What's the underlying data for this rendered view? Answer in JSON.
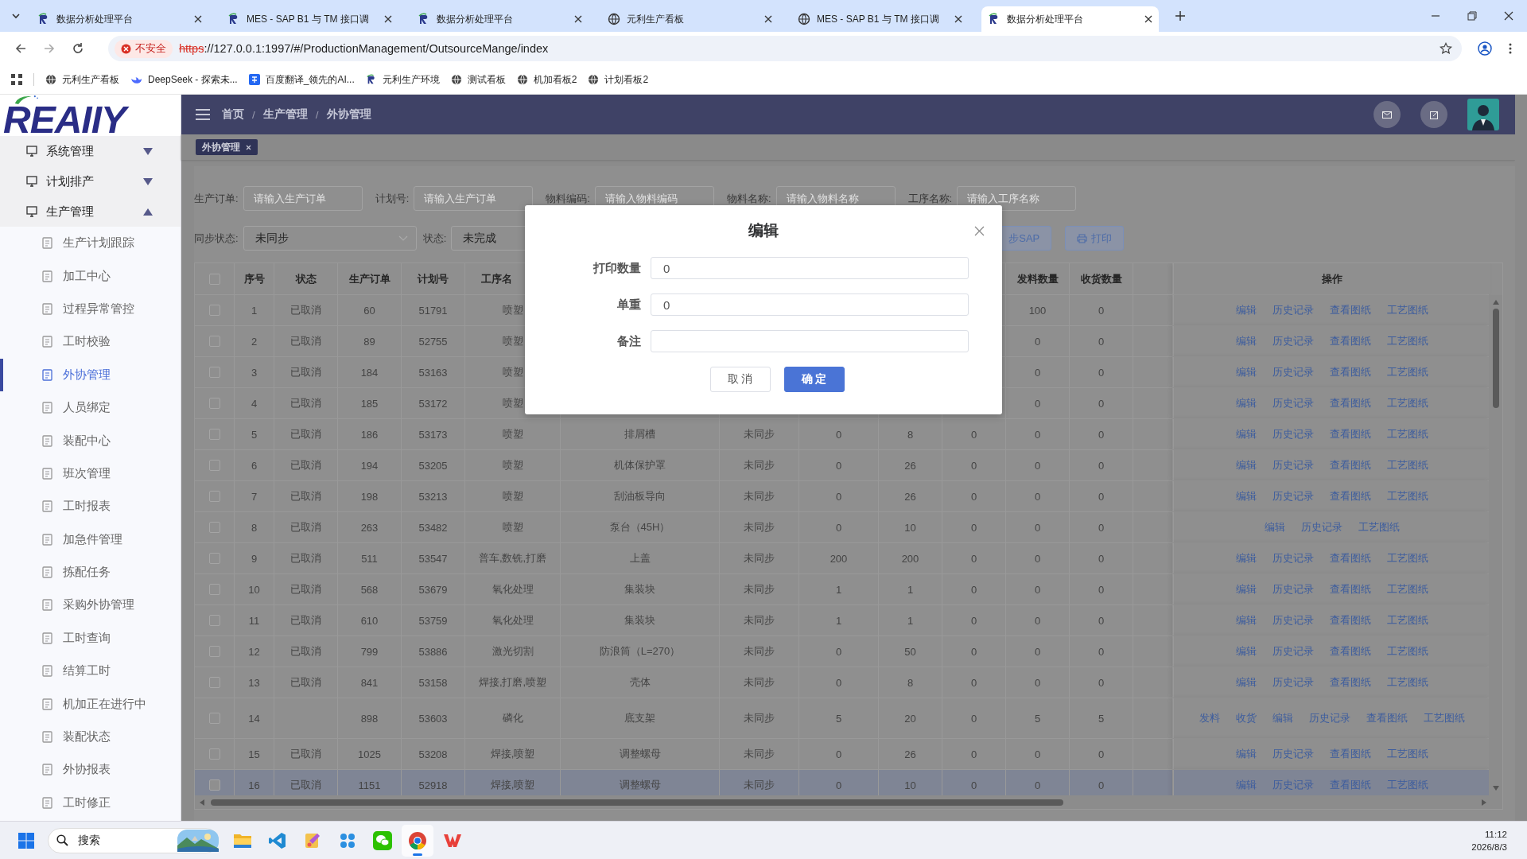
{
  "browser": {
    "tabs": [
      {
        "title": "数据分析处理平台",
        "kind": "app",
        "selected": false
      },
      {
        "title": "MES - SAP B1 与 TM 接口调",
        "kind": "app",
        "selected": false
      },
      {
        "title": "数据分析处理平台",
        "kind": "app",
        "selected": false
      },
      {
        "title": "元利生产看板",
        "kind": "globe",
        "selected": false
      },
      {
        "title": "MES - SAP B1 与 TM 接口调",
        "kind": "globe",
        "selected": false
      },
      {
        "title": "数据分析处理平台",
        "kind": "app",
        "selected": true
      }
    ],
    "security": "不安全",
    "url_scheme": "https",
    "url_rest": "://127.0.0.1:1997/#/ProductionManagement/OutsourceMange/index",
    "bookmarks": [
      {
        "label": "元利生产看板",
        "kind": "globe"
      },
      {
        "label": "DeepSeek - 探索未...",
        "kind": "whale"
      },
      {
        "label": "百度翻译_领先的AI...",
        "kind": "translate"
      },
      {
        "label": "元利生产环境",
        "kind": "app"
      },
      {
        "label": "测试看板",
        "kind": "globe"
      },
      {
        "label": "机加看板2",
        "kind": "globe"
      },
      {
        "label": "计划看板2",
        "kind": "globe"
      }
    ]
  },
  "sidebar": {
    "logo": "REAIIY",
    "menu": [
      {
        "label": "系统管理",
        "expanded": false
      },
      {
        "label": "计划排产",
        "expanded": false
      },
      {
        "label": "生产管理",
        "expanded": true,
        "children": [
          {
            "label": "生产计划跟踪",
            "selected": false
          },
          {
            "label": "加工中心",
            "selected": false
          },
          {
            "label": "过程异常管控",
            "selected": false
          },
          {
            "label": "工时校验",
            "selected": false
          },
          {
            "label": "外协管理",
            "selected": true
          },
          {
            "label": "人员绑定",
            "selected": false
          },
          {
            "label": "装配中心",
            "selected": false
          },
          {
            "label": "班次管理",
            "selected": false
          },
          {
            "label": "工时报表",
            "selected": false
          },
          {
            "label": "加急件管理",
            "selected": false
          },
          {
            "label": "拣配任务",
            "selected": false
          },
          {
            "label": "采购外协管理",
            "selected": false
          },
          {
            "label": "工时查询",
            "selected": false
          },
          {
            "label": "结算工时",
            "selected": false
          },
          {
            "label": "机加正在进行中",
            "selected": false
          },
          {
            "label": "装配状态",
            "selected": false
          },
          {
            "label": "外协报表",
            "selected": false
          },
          {
            "label": "工时修正",
            "selected": false
          }
        ]
      }
    ]
  },
  "header": {
    "breadcrumb": [
      "首页",
      "生产管理",
      "外协管理"
    ],
    "separator": "/"
  },
  "tags": [
    {
      "label": "外协管理",
      "selected": true
    }
  ],
  "filters": [
    {
      "label": "生产订单:",
      "placeholder": "请输入生产订单"
    },
    {
      "label": "计划号:",
      "placeholder": "请输入生产订单"
    },
    {
      "label": "物料编码:",
      "placeholder": "请输入物料编码"
    },
    {
      "label": "物料名称:",
      "placeholder": "请输入物料名称"
    },
    {
      "label": "工序名称:",
      "placeholder": "请输入工序名称"
    }
  ],
  "selects": [
    {
      "label": "同步状态:",
      "value": "未同步"
    },
    {
      "label": "状态:",
      "value": "未完成"
    }
  ],
  "toolbar_buttons": [
    {
      "label": "步SAP",
      "kind": "plain"
    },
    {
      "label": "打印",
      "kind": "print"
    }
  ],
  "table": {
    "header_checked": false,
    "columns": [
      "序号",
      "状态",
      "生产订单",
      "计划号",
      "工序名",
      null,
      null,
      null,
      null,
      null,
      "发料数量",
      "收货数量"
    ],
    "actions_header": "操作",
    "rows": [
      {
        "checked": false,
        "selected": false,
        "cells": [
          "1",
          "已取消",
          "60",
          "51791",
          "喷塑",
          null,
          null,
          null,
          null,
          null,
          "100",
          "0"
        ],
        "actions": [
          "编辑",
          "历史记录",
          "查看图纸",
          "工艺图纸"
        ]
      },
      {
        "checked": false,
        "selected": false,
        "cells": [
          "2",
          "已取消",
          "89",
          "52755",
          "喷塑",
          null,
          null,
          null,
          null,
          null,
          "0",
          "0"
        ],
        "actions": [
          "编辑",
          "历史记录",
          "查看图纸",
          "工艺图纸"
        ]
      },
      {
        "checked": false,
        "selected": false,
        "cells": [
          "3",
          "已取消",
          "184",
          "53163",
          "喷塑",
          null,
          null,
          null,
          null,
          null,
          "0",
          "0"
        ],
        "actions": [
          "编辑",
          "历史记录",
          "查看图纸",
          "工艺图纸"
        ]
      },
      {
        "checked": false,
        "selected": false,
        "cells": [
          "4",
          "已取消",
          "185",
          "53172",
          "喷塑",
          null,
          null,
          null,
          null,
          null,
          "0",
          "0"
        ],
        "actions": [
          "编辑",
          "历史记录",
          "查看图纸",
          "工艺图纸"
        ]
      },
      {
        "checked": false,
        "selected": false,
        "cells": [
          "5",
          "已取消",
          "186",
          "53173",
          "喷塑",
          "排屑槽",
          "未同步",
          "0",
          "8",
          "0",
          "0",
          "0"
        ],
        "actions": [
          "编辑",
          "历史记录",
          "查看图纸",
          "工艺图纸"
        ]
      },
      {
        "checked": false,
        "selected": false,
        "cells": [
          "6",
          "已取消",
          "194",
          "53205",
          "喷塑",
          "机体保护罩",
          "未同步",
          "0",
          "26",
          "0",
          "0",
          "0"
        ],
        "actions": [
          "编辑",
          "历史记录",
          "查看图纸",
          "工艺图纸"
        ]
      },
      {
        "checked": false,
        "selected": false,
        "cells": [
          "7",
          "已取消",
          "198",
          "53213",
          "喷塑",
          "刮油板导向",
          "未同步",
          "0",
          "26",
          "0",
          "0",
          "0"
        ],
        "actions": [
          "编辑",
          "历史记录",
          "查看图纸",
          "工艺图纸"
        ]
      },
      {
        "checked": false,
        "selected": false,
        "cells": [
          "8",
          "已取消",
          "263",
          "53482",
          "喷塑",
          "泵台（45H）",
          "未同步",
          "0",
          "10",
          "0",
          "0",
          "0"
        ],
        "actions": [
          "编辑",
          "历史记录",
          "工艺图纸"
        ]
      },
      {
        "checked": false,
        "selected": false,
        "cells": [
          "9",
          "已取消",
          "511",
          "53547",
          "普车,数铣,打磨",
          "上盖",
          "未同步",
          "200",
          "200",
          "0",
          "0",
          "0"
        ],
        "actions": [
          "编辑",
          "历史记录",
          "查看图纸",
          "工艺图纸"
        ]
      },
      {
        "checked": false,
        "selected": false,
        "cells": [
          "10",
          "已取消",
          "568",
          "53679",
          "氧化处理",
          "集装块",
          "未同步",
          "1",
          "1",
          "0",
          "0",
          "0"
        ],
        "actions": [
          "编辑",
          "历史记录",
          "查看图纸",
          "工艺图纸"
        ]
      },
      {
        "checked": false,
        "selected": false,
        "cells": [
          "11",
          "已取消",
          "610",
          "53759",
          "氧化处理",
          "集装块",
          "未同步",
          "1",
          "1",
          "0",
          "0",
          "0"
        ],
        "actions": [
          "编辑",
          "历史记录",
          "查看图纸",
          "工艺图纸"
        ]
      },
      {
        "checked": false,
        "selected": false,
        "cells": [
          "12",
          "已取消",
          "799",
          "53886",
          "激光切割",
          "防浪筒（L=270）",
          "未同步",
          "0",
          "50",
          "0",
          "0",
          "0"
        ],
        "actions": [
          "编辑",
          "历史记录",
          "查看图纸",
          "工艺图纸"
        ]
      },
      {
        "checked": false,
        "selected": false,
        "cells": [
          "13",
          "已取消",
          "841",
          "53158",
          "焊接,打磨,喷塑",
          "壳体",
          "未同步",
          "0",
          "8",
          "0",
          "0",
          "0"
        ],
        "actions": [
          "编辑",
          "历史记录",
          "查看图纸",
          "工艺图纸"
        ]
      },
      {
        "checked": false,
        "selected": false,
        "cells": [
          "14",
          null,
          "898",
          "53603",
          "磷化",
          "底支架",
          "未同步",
          "5",
          "20",
          "0",
          "5",
          "5"
        ],
        "actions": [
          "发料",
          "收货",
          "编辑",
          "历史记录",
          "查看图纸",
          "工艺图纸"
        ]
      },
      {
        "checked": false,
        "selected": false,
        "cells": [
          "15",
          "已取消",
          "1025",
          "53208",
          "焊接,喷塑",
          "调整螺母",
          "未同步",
          "0",
          "26",
          "0",
          "0",
          "0"
        ],
        "actions": [
          "编辑",
          "历史记录",
          "查看图纸",
          "工艺图纸"
        ]
      },
      {
        "checked": false,
        "selected": true,
        "cells": [
          "16",
          "已取消",
          "1151",
          "52918",
          "焊接,喷塑",
          "调整螺母",
          "未同步",
          "0",
          "10",
          "0",
          "0",
          "0"
        ],
        "actions": [
          "编辑",
          "历史记录",
          "查看图纸",
          "工艺图纸"
        ]
      }
    ]
  },
  "dialog": {
    "title": "编辑",
    "fields": [
      {
        "label": "打印数量",
        "value": "0"
      },
      {
        "label": "单重",
        "value": "0"
      },
      {
        "label": "备注"
      }
    ],
    "buttons": [
      {
        "label": "取 消",
        "kind": "default"
      },
      {
        "label": "确 定",
        "kind": "primary"
      }
    ]
  },
  "taskbar": {
    "search_placeholder": "搜索",
    "apps": [
      {
        "kind": "explorer",
        "selected": false
      },
      {
        "kind": "vscode",
        "selected": false
      },
      {
        "kind": "paint",
        "selected": false
      },
      {
        "kind": "app",
        "selected": false
      },
      {
        "kind": "wechat",
        "selected": false
      },
      {
        "kind": "chrome",
        "selected": true
      },
      {
        "kind": "wps",
        "selected": false
      }
    ],
    "time": "11:12",
    "date": "2026/8/3"
  }
}
